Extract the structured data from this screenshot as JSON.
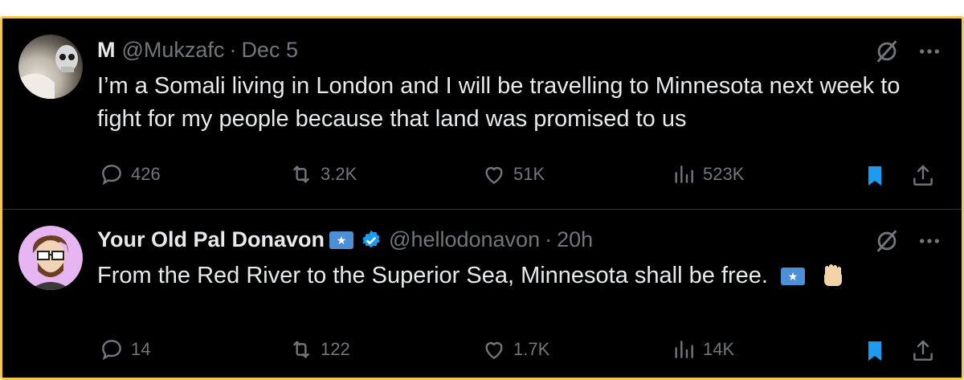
{
  "tweets": [
    {
      "name": "M",
      "handle": "@Mukzafc",
      "sep": "·",
      "time": "Dec 5",
      "text": "I’m a Somali living in London and I will be travelling to Minnesota next week to fight for my people because that land was promised to us",
      "replies": "426",
      "retweets": "3.2K",
      "likes": "51K",
      "views": "523K",
      "bookmarked": true
    },
    {
      "name": "Your Old Pal Donavon",
      "flag": "★",
      "verified": true,
      "handle": "@hellodonavon",
      "sep": "·",
      "time": "20h",
      "text": "From the Red River to the Superior Sea, Minnesota shall be free.",
      "text_flag": "★",
      "replies": "14",
      "retweets": "122",
      "likes": "1.7K",
      "views": "14K",
      "bookmarked": true
    }
  ],
  "colors": {
    "background": "#000000",
    "frame_border": "#f2c94c",
    "text": "#e7e9ea",
    "muted": "#71767b",
    "accent_blue": "#1d9bf0"
  },
  "icons": [
    "reply-icon",
    "retweet-icon",
    "like-icon",
    "views-icon",
    "bookmark-icon",
    "share-icon",
    "grok-icon",
    "more-icon",
    "verified-icon",
    "flag-icon",
    "raised-fist-icon"
  ]
}
